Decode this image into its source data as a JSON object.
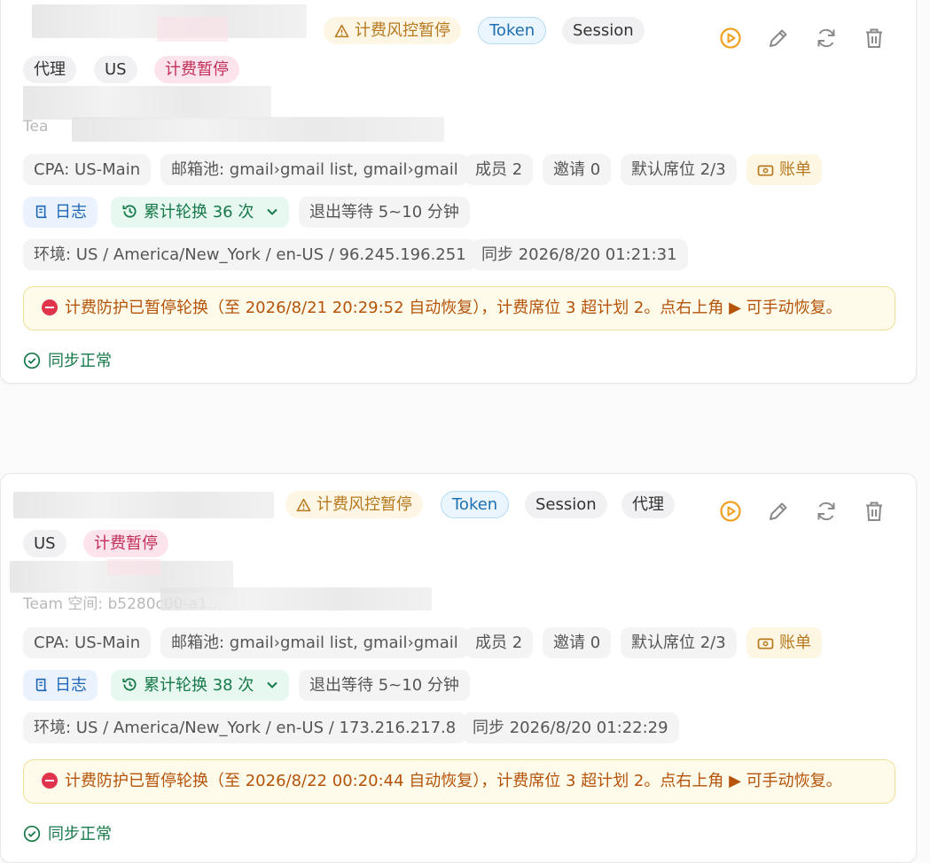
{
  "cards": [
    {
      "tags": {
        "risk_pause": "计费风控暂停",
        "token": "Token",
        "session": "Session",
        "proxy": "代理",
        "region": "US",
        "billing_pause": "计费暂停"
      },
      "faded_text": "Tea",
      "meta": {
        "cpa": "CPA: US-Main",
        "mailbox": "邮箱池: gmail›gmail list, gmail›gmail",
        "members": "成员 2",
        "invites": "邀请 0",
        "seats": "默认席位 2/3",
        "bill": "账单",
        "log": "日志",
        "rotations": "累计轮换 36 次",
        "exit_wait": "退出等待 5~10 分钟",
        "env": "环境: US / America/New_York / en-US / 96.245.196.251",
        "synced": "同步 2026/8/20 01:21:31"
      },
      "alert": "计费防护已暂停轮换（至 2026/8/21 20:29:52 自动恢复），计费席位 3 超计划 2。点右上角 ▶ 可手动恢复。",
      "status": "同步正常"
    },
    {
      "tags": {
        "risk_pause": "计费风控暂停",
        "token": "Token",
        "session": "Session",
        "proxy": "代理",
        "region": "US",
        "billing_pause": "计费暂停"
      },
      "faded_text": "Team 空间: b5280c00-a1...",
      "meta": {
        "cpa": "CPA: US-Main",
        "mailbox": "邮箱池: gmail›gmail list, gmail›gmail",
        "members": "成员 2",
        "invites": "邀请 0",
        "seats": "默认席位 2/3",
        "bill": "账单",
        "log": "日志",
        "rotations": "累计轮换 38 次",
        "exit_wait": "退出等待 5~10 分钟",
        "env": "环境: US / America/New_York / en-US / 173.216.217.8",
        "synced": "同步 2026/8/20 01:22:29"
      },
      "alert": "计费防护已暂停轮换（至 2026/8/22 00:20:44 自动恢复），计费席位 3 超计划 2。点右上角 ▶ 可手动恢复。",
      "status": "同步正常"
    }
  ],
  "icons": [
    "play-circle-icon",
    "pencil-icon",
    "refresh-icon",
    "trash-icon",
    "warning-triangle-icon",
    "bill-icon",
    "log-icon",
    "history-icon",
    "chevron-down-icon",
    "stop-icon",
    "check-circle-icon"
  ],
  "colors": {
    "warning": "#b7791f",
    "play": "#f0a020",
    "success": "#17794a",
    "danger": "#e0344c",
    "token_blue": "#1f6fb2"
  }
}
